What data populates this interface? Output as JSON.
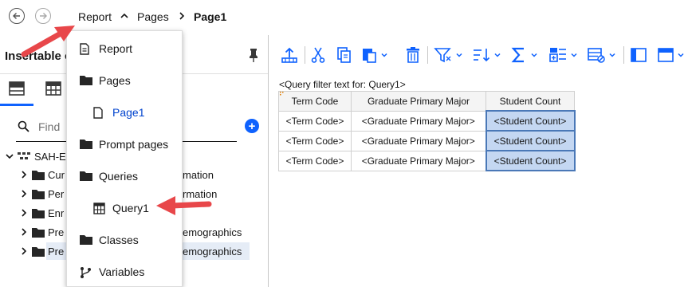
{
  "breadcrumb": {
    "items": [
      "Report",
      "Pages",
      "Page1"
    ]
  },
  "left_panel": {
    "title": "Insertable o",
    "search_placeholder": "Find",
    "tree": [
      {
        "label": "SAH-E",
        "right": ""
      },
      {
        "label": "Cur",
        "right": "mation"
      },
      {
        "label": "Per",
        "right": "rmation"
      },
      {
        "label": "Enr",
        "right": ""
      },
      {
        "label": "Pre",
        "right": "emographics"
      },
      {
        "label": "Pre",
        "right": "emographics"
      }
    ]
  },
  "menu": {
    "items": [
      {
        "label": "Report",
        "icon": "document-icon"
      },
      {
        "label": "Pages",
        "icon": "folder-icon"
      },
      {
        "label": "Page1",
        "icon": "page-icon"
      },
      {
        "label": "Prompt pages",
        "icon": "folder-icon"
      },
      {
        "label": "Queries",
        "icon": "folder-icon"
      },
      {
        "label": "Query1",
        "icon": "query-icon"
      },
      {
        "label": "Classes",
        "icon": "folder-icon"
      },
      {
        "label": "Variables",
        "icon": "branch-icon"
      }
    ]
  },
  "report": {
    "filter_text": "<Query filter text for: Query1>",
    "columns": [
      "Term Code",
      "Graduate Primary Major",
      "Student Count"
    ],
    "rows": [
      [
        "<Term Code>",
        "<Graduate Primary Major>",
        "<Student Count>"
      ],
      [
        "<Term Code>",
        "<Graduate Primary Major>",
        "<Student Count>"
      ],
      [
        "<Term Code>",
        "<Graduate Primary Major>",
        "<Student Count>"
      ]
    ]
  },
  "colors": {
    "accent": "#0f62fe",
    "selection": "#c4d7f2",
    "annotation_arrow": "#e8474a"
  }
}
